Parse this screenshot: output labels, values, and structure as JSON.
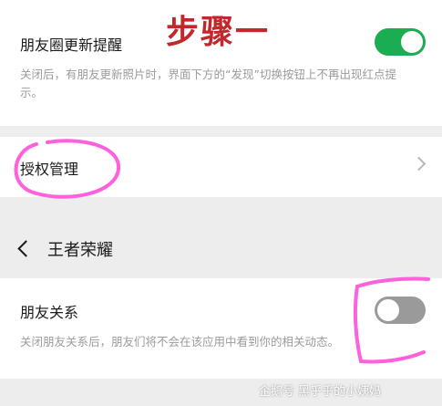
{
  "step_label": "步骤一",
  "moments_setting": {
    "title": "朋友圈更新提醒",
    "description": "关闭后，有朋友更新照片时，界面下方的“发现”切换按钮上不再出现红点提示。",
    "toggle_on": true
  },
  "authorization": {
    "title": "授权管理",
    "icon": "chevron-right-icon"
  },
  "app_nav": {
    "back_icon": "back-arrow-icon",
    "title": "王者荣耀"
  },
  "friend_relation": {
    "title": "朋友关系",
    "description": "关闭朋友关系后，朋友们将不会在该应用中看到你的相关动态。",
    "toggle_on": false
  },
  "watermark": "企鹅号 黑乎乎的小姨妈",
  "colors": {
    "toggle_on": "#1aad52",
    "toggle_off": "#9a9a9a",
    "step_label": "#c0282c",
    "highlight": "#ff4fd8"
  }
}
